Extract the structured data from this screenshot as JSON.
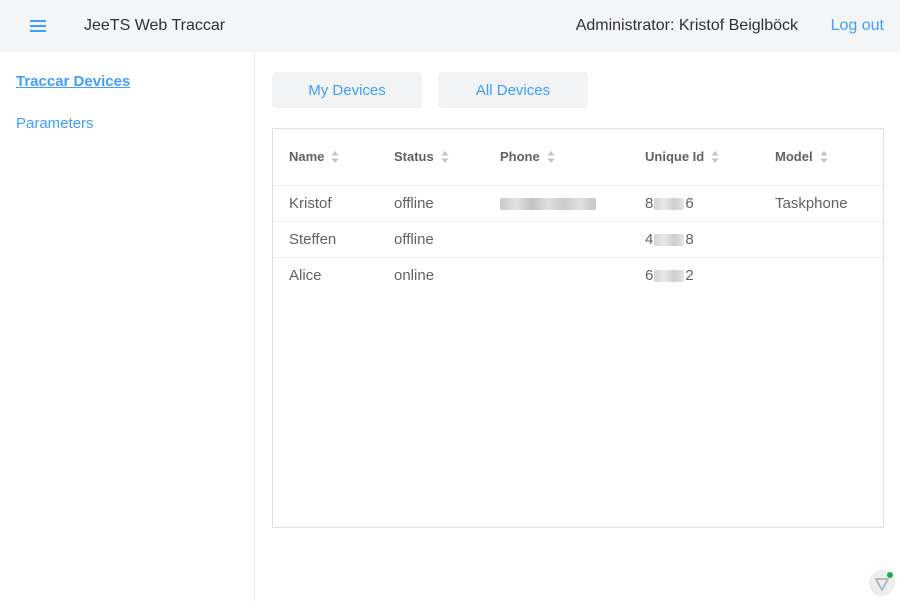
{
  "header": {
    "title": "JeeTS Web Traccar",
    "user": "Administrator: Kristof Beiglböck",
    "logout": "Log out"
  },
  "sidebar": {
    "items": [
      {
        "label": "Traccar Devices"
      },
      {
        "label": "Parameters"
      }
    ]
  },
  "tabs": [
    {
      "label": "My Devices"
    },
    {
      "label": "All Devices"
    }
  ],
  "table": {
    "columns": [
      "Name",
      "Status",
      "Phone",
      "Unique Id",
      "Model"
    ],
    "rows": [
      {
        "name": "Kristof",
        "status": "offline",
        "uid_start": "8",
        "uid_end": "6",
        "model": "Taskphone"
      },
      {
        "name": "Steffen",
        "status": "offline",
        "uid_start": "4",
        "uid_end": "8",
        "model": ""
      },
      {
        "name": "Alice",
        "status": "online",
        "uid_start": "6",
        "uid_end": "2",
        "model": ""
      }
    ]
  },
  "colors": {
    "accent": "#409eff",
    "header_bg": "#f4f5f7",
    "online_dot": "#22aa44"
  }
}
